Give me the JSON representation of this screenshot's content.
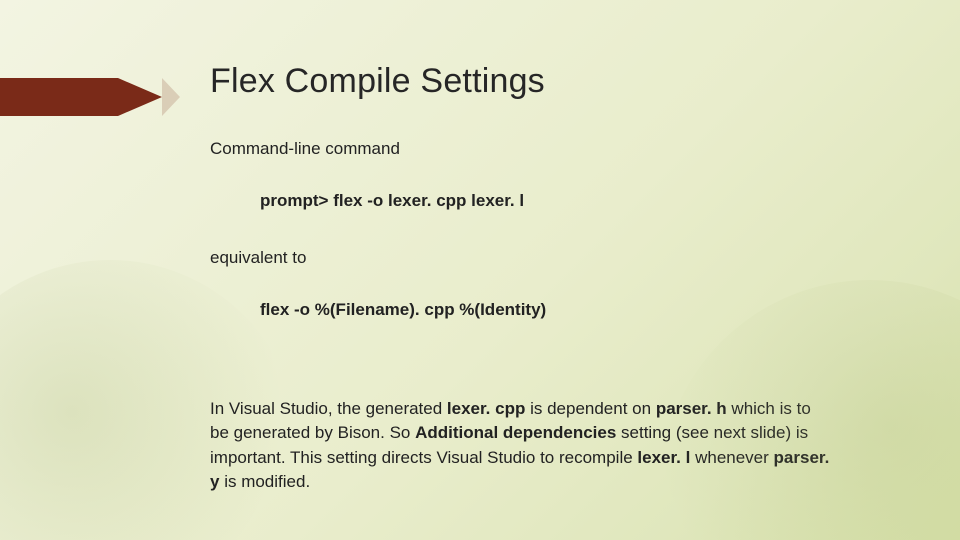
{
  "title": "Flex Compile Settings",
  "lines": {
    "l1": "Command-line command",
    "cmd1": "prompt> flex -o lexer. cpp lexer. l",
    "l2": "equivalent to",
    "cmd2": "flex -o %(Filename). cpp %(Identity)"
  },
  "paragraph": {
    "p1": "In Visual Studio, the generated ",
    "b1": "lexer. cpp",
    "p2": " is dependent on ",
    "b2": "parser. h",
    "p3": " which is to be generated by Bison. So ",
    "b3": "Additional dependencies",
    "p4": " setting (see next slide) is important. This setting directs Visual Studio to recompile ",
    "b4": "lexer. l",
    "p5": " whenever ",
    "b5": "parser. y",
    "p6": " is modified."
  }
}
